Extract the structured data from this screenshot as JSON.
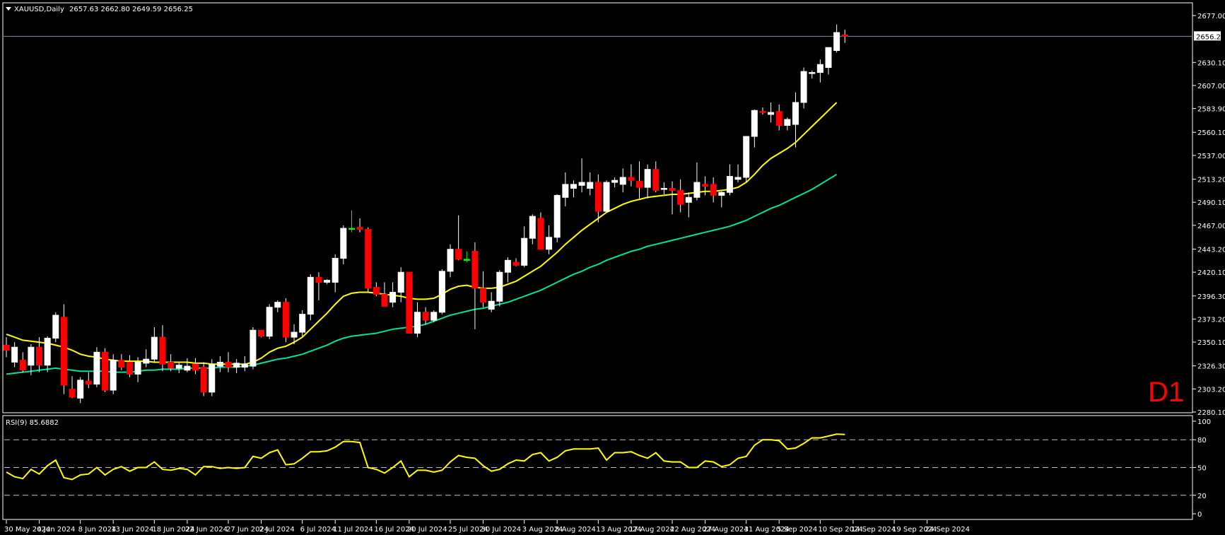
{
  "header": {
    "symbol_label": "XAUUSD,Daily",
    "ohlc_label": "2657.63 2662.80 2649.59 2656.25"
  },
  "timeframe_label": "D1",
  "price_tag": "2656.25",
  "rsi_label": "RSI(9) 85.6882",
  "colors": {
    "background": "#000000",
    "bull_candle": "#ffffff",
    "bear_candle": "#ff0000",
    "doji_candle": "#00ff00",
    "ma_fast": "#ffff00",
    "ma_slow": "#00e0a0",
    "rsi_line": "#ffff00",
    "frame": "#ffffff"
  },
  "chart_data": [
    {
      "type": "candlestick",
      "symbol": "XAUUSD",
      "period": "Daily",
      "ylim": [
        2280.1,
        2677.0
      ],
      "y_ticks": [
        2677.0,
        2630.1,
        2607.0,
        2583.9,
        2560.1,
        2537.0,
        2513.2,
        2490.1,
        2467.0,
        2443.2,
        2420.1,
        2396.3,
        2373.2,
        2350.1,
        2326.3,
        2303.2,
        2280.1
      ],
      "x_tick_labels": [
        "30 May 2024",
        "4 Jun 2024",
        "8 Jun 2024",
        "13 Jun 2024",
        "18 Jun 2024",
        "22 Jun 2024",
        "27 Jun 2024",
        "2 Jul 2024",
        "6 Jul 2024",
        "11 Jul 2024",
        "16 Jul 2024",
        "20 Jul 2024",
        "25 Jul 2024",
        "30 Jul 2024",
        "3 Aug 2024",
        "8 Aug 2024",
        "13 Aug 2024",
        "17 Aug 2024",
        "22 Aug 2024",
        "27 Aug 2024",
        "31 Aug 2024",
        "5 Sep 2024",
        "10 Sep 2024",
        "14 Sep 2024",
        "19 Sep 2024",
        "24 Sep 2024"
      ],
      "x_tick_index": [
        0,
        4,
        9,
        13,
        18,
        22,
        27,
        31,
        36,
        40,
        45,
        49,
        54,
        58,
        63,
        67,
        72,
        76,
        81,
        85,
        90,
        94,
        99,
        103,
        108,
        112
      ],
      "current_price": 2656.25,
      "ohlc": [
        [
          2347,
          2355,
          2335,
          2342
        ],
        [
          2330,
          2350,
          2325,
          2345
        ],
        [
          2332,
          2340,
          2320,
          2322
        ],
        [
          2327,
          2348,
          2317,
          2345
        ],
        [
          2345,
          2355,
          2320,
          2327
        ],
        [
          2327,
          2356,
          2320,
          2354
        ],
        [
          2354,
          2380,
          2350,
          2377
        ],
        [
          2375,
          2388,
          2298,
          2307
        ],
        [
          2303,
          2316,
          2294,
          2295
        ],
        [
          2294,
          2315,
          2289,
          2312
        ],
        [
          2311,
          2320,
          2304,
          2308
        ],
        [
          2308,
          2345,
          2305,
          2340
        ],
        [
          2340,
          2344,
          2300,
          2302
        ],
        [
          2302,
          2338,
          2298,
          2332
        ],
        [
          2332,
          2338,
          2322,
          2325
        ],
        [
          2330,
          2337,
          2315,
          2318
        ],
        [
          2318,
          2335,
          2310,
          2330
        ],
        [
          2329,
          2343,
          2325,
          2333
        ],
        [
          2333,
          2365,
          2330,
          2355
        ],
        [
          2355,
          2367,
          2321,
          2328
        ],
        [
          2330,
          2338,
          2321,
          2324
        ],
        [
          2324,
          2330,
          2319,
          2327
        ],
        [
          2322,
          2334,
          2320,
          2326
        ],
        [
          2328,
          2334,
          2318,
          2322
        ],
        [
          2325,
          2330,
          2296,
          2300
        ],
        [
          2300,
          2333,
          2296,
          2328
        ],
        [
          2326,
          2336,
          2320,
          2330
        ],
        [
          2330,
          2340,
          2320,
          2325
        ],
        [
          2325,
          2333,
          2319,
          2329
        ],
        [
          2325,
          2336,
          2321,
          2328
        ],
        [
          2326,
          2365,
          2323,
          2362
        ],
        [
          2362,
          2362,
          2355,
          2356
        ],
        [
          2356,
          2388,
          2353,
          2385
        ],
        [
          2385,
          2392,
          2380,
          2390
        ],
        [
          2390,
          2394,
          2350,
          2355
        ],
        [
          2355,
          2368,
          2348,
          2360
        ],
        [
          2360,
          2382,
          2356,
          2378
        ],
        [
          2378,
          2418,
          2372,
          2415
        ],
        [
          2415,
          2420,
          2392,
          2410
        ],
        [
          2410,
          2413,
          2408,
          2412
        ],
        [
          2410,
          2438,
          2400,
          2434
        ],
        [
          2434,
          2467,
          2428,
          2464
        ],
        [
          2464,
          2482,
          2460,
          2464
        ],
        [
          2465,
          2474,
          2460,
          2463
        ],
        [
          2463,
          2465,
          2400,
          2404
        ],
        [
          2405,
          2410,
          2396,
          2398
        ],
        [
          2398,
          2410,
          2387,
          2386
        ],
        [
          2390,
          2410,
          2385,
          2400
        ],
        [
          2400,
          2425,
          2390,
          2420
        ],
        [
          2420,
          2420,
          2360,
          2359
        ],
        [
          2359,
          2390,
          2355,
          2380
        ],
        [
          2380,
          2385,
          2368,
          2372
        ],
        [
          2372,
          2382,
          2370,
          2380
        ],
        [
          2380,
          2423,
          2378,
          2421
        ],
        [
          2421,
          2448,
          2415,
          2443
        ],
        [
          2443,
          2477,
          2432,
          2433
        ],
        [
          2433,
          2441,
          2430,
          2433
        ],
        [
          2441,
          2450,
          2363,
          2404
        ],
        [
          2404,
          2421,
          2385,
          2390
        ],
        [
          2383,
          2400,
          2380,
          2391
        ],
        [
          2391,
          2422,
          2386,
          2420
        ],
        [
          2420,
          2435,
          2410,
          2432
        ],
        [
          2430,
          2434,
          2426,
          2427
        ],
        [
          2427,
          2466,
          2425,
          2454
        ],
        [
          2454,
          2478,
          2448,
          2476
        ],
        [
          2474,
          2480,
          2443,
          2443
        ],
        [
          2443,
          2467,
          2438,
          2455
        ],
        [
          2455,
          2498,
          2450,
          2497
        ],
        [
          2495,
          2520,
          2486,
          2508
        ],
        [
          2504,
          2512,
          2495,
          2508
        ],
        [
          2507,
          2534,
          2500,
          2510
        ],
        [
          2504,
          2520,
          2497,
          2510
        ],
        [
          2510,
          2518,
          2470,
          2481
        ],
        [
          2481,
          2512,
          2480,
          2510
        ],
        [
          2510,
          2515,
          2505,
          2512
        ],
        [
          2508,
          2524,
          2500,
          2515
        ],
        [
          2515,
          2528,
          2506,
          2512
        ],
        [
          2511,
          2531,
          2494,
          2505
        ],
        [
          2505,
          2528,
          2494,
          2523
        ],
        [
          2523,
          2531,
          2500,
          2502
        ],
        [
          2503,
          2510,
          2498,
          2504
        ],
        [
          2504,
          2511,
          2478,
          2502
        ],
        [
          2502,
          2513,
          2480,
          2488
        ],
        [
          2490,
          2500,
          2475,
          2495
        ],
        [
          2495,
          2530,
          2492,
          2510
        ],
        [
          2508,
          2516,
          2497,
          2506
        ],
        [
          2508,
          2515,
          2490,
          2497
        ],
        [
          2497,
          2501,
          2485,
          2500
        ],
        [
          2500,
          2528,
          2497,
          2516
        ],
        [
          2513,
          2528,
          2510,
          2515
        ],
        [
          2515,
          2556,
          2510,
          2556
        ],
        [
          2556,
          2583,
          2545,
          2582
        ],
        [
          2581,
          2585,
          2578,
          2580
        ],
        [
          2578,
          2590,
          2570,
          2580
        ],
        [
          2581,
          2588,
          2562,
          2567
        ],
        [
          2567,
          2575,
          2562,
          2573
        ],
        [
          2568,
          2600,
          2545,
          2590
        ],
        [
          2590,
          2625,
          2584,
          2621
        ],
        [
          2619,
          2622,
          2614,
          2620
        ],
        [
          2620,
          2633,
          2610,
          2628
        ],
        [
          2625,
          2645,
          2618,
          2645
        ],
        [
          2642,
          2668,
          2640,
          2660
        ],
        [
          2657.63,
          2662.8,
          2649.59,
          2656.25
        ]
      ],
      "ma_fast": [
        2358,
        2355,
        2352,
        2351,
        2350,
        2349,
        2347,
        2345,
        2342,
        2338,
        2336,
        2335,
        2333,
        2332,
        2331,
        2331,
        2331,
        2331,
        2330,
        2330,
        2330,
        2330,
        2330,
        2329,
        2329,
        2328,
        2328,
        2328,
        2328,
        2328,
        2330,
        2334,
        2340,
        2344,
        2346,
        2350,
        2355,
        2363,
        2371,
        2379,
        2388,
        2396,
        2399,
        2400,
        2400,
        2399,
        2398,
        2397,
        2396,
        2394,
        2393,
        2393,
        2394,
        2398,
        2403,
        2406,
        2407,
        2405,
        2404,
        2404,
        2405,
        2408,
        2411,
        2416,
        2421,
        2426,
        2433,
        2440,
        2448,
        2455,
        2462,
        2468,
        2474,
        2480,
        2484,
        2488,
        2491,
        2493,
        2495,
        2496,
        2497,
        2498,
        2498,
        2499,
        2500,
        2501,
        2501,
        2502,
        2503,
        2505,
        2510,
        2518,
        2527,
        2534,
        2539,
        2544,
        2550,
        2558,
        2566,
        2574,
        2582,
        2590
      ],
      "ma_slow": [
        2318,
        2319,
        2320,
        2321,
        2322,
        2323,
        2324,
        2323,
        2322,
        2321,
        2321,
        2321,
        2321,
        2320,
        2320,
        2320,
        2321,
        2322,
        2322,
        2323,
        2323,
        2323,
        2324,
        2324,
        2324,
        2324,
        2325,
        2325,
        2325,
        2326,
        2327,
        2329,
        2331,
        2333,
        2334,
        2336,
        2338,
        2341,
        2344,
        2347,
        2351,
        2354,
        2356,
        2357,
        2358,
        2359,
        2361,
        2363,
        2364,
        2365,
        2366,
        2368,
        2371,
        2374,
        2377,
        2379,
        2381,
        2383,
        2384,
        2386,
        2388,
        2390,
        2393,
        2396,
        2399,
        2402,
        2406,
        2410,
        2414,
        2418,
        2421,
        2425,
        2428,
        2432,
        2435,
        2438,
        2441,
        2443,
        2446,
        2448,
        2450,
        2452,
        2454,
        2456,
        2458,
        2460,
        2462,
        2464,
        2466,
        2469,
        2472,
        2476,
        2480,
        2484,
        2487,
        2491,
        2495,
        2499,
        2503,
        2508,
        2513,
        2518
      ]
    },
    {
      "type": "line",
      "series": [
        {
          "name": "RSI(9)",
          "values": [
            45,
            40,
            38,
            48,
            43,
            52,
            58,
            39,
            37,
            42,
            43,
            50,
            42,
            48,
            51,
            46,
            50,
            50,
            56,
            48,
            47,
            49,
            48,
            42,
            51,
            51,
            49,
            50,
            49,
            50,
            62,
            60,
            66,
            69,
            53,
            54,
            60,
            67,
            67,
            68,
            72,
            78,
            78,
            77,
            50,
            48,
            44,
            50,
            57,
            40,
            47,
            47,
            45,
            47,
            56,
            63,
            61,
            60,
            52,
            46,
            48,
            54,
            58,
            57,
            64,
            66,
            57,
            61,
            68,
            70,
            70,
            70,
            71,
            58,
            66,
            66,
            67,
            63,
            60,
            66,
            57,
            56,
            56,
            50,
            50,
            57,
            56,
            51,
            53,
            60,
            62,
            74,
            80,
            80,
            79,
            70,
            71,
            76,
            82,
            82,
            84,
            86,
            85.69
          ]
        }
      ],
      "ylim": [
        0,
        100
      ],
      "y_ticks": [
        100,
        80,
        50,
        20,
        0
      ],
      "levels": [
        80,
        50,
        20
      ]
    }
  ]
}
